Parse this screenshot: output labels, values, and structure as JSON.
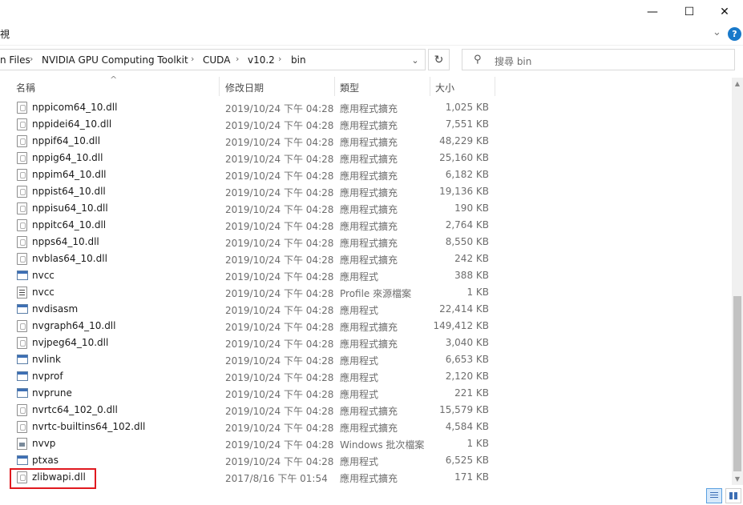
{
  "window": {
    "minimize_glyph": "—",
    "maximize_glyph": "☐",
    "close_glyph": "✕"
  },
  "ribbon": {
    "tab_fragment": "視",
    "help_glyph": "?"
  },
  "address": {
    "crumbs": [
      "n Files",
      "NVIDIA GPU Computing Toolkit",
      "CUDA",
      "v10.2",
      "bin"
    ],
    "separator": "›"
  },
  "search": {
    "placeholder": "搜尋 bin"
  },
  "columns": {
    "name": "名稱",
    "date": "修改日期",
    "type": "類型",
    "size": "大小"
  },
  "files": [
    {
      "name": "nppicom64_10.dll",
      "date": "2019/10/24 下午 04:28",
      "type": "應用程式擴充",
      "size": "1,025 KB",
      "icon": "dll-icon"
    },
    {
      "name": "nppidei64_10.dll",
      "date": "2019/10/24 下午 04:28",
      "type": "應用程式擴充",
      "size": "7,551 KB",
      "icon": "dll-icon"
    },
    {
      "name": "nppif64_10.dll",
      "date": "2019/10/24 下午 04:28",
      "type": "應用程式擴充",
      "size": "48,229 KB",
      "icon": "dll-icon"
    },
    {
      "name": "nppig64_10.dll",
      "date": "2019/10/24 下午 04:28",
      "type": "應用程式擴充",
      "size": "25,160 KB",
      "icon": "dll-icon"
    },
    {
      "name": "nppim64_10.dll",
      "date": "2019/10/24 下午 04:28",
      "type": "應用程式擴充",
      "size": "6,182 KB",
      "icon": "dll-icon"
    },
    {
      "name": "nppist64_10.dll",
      "date": "2019/10/24 下午 04:28",
      "type": "應用程式擴充",
      "size": "19,136 KB",
      "icon": "dll-icon"
    },
    {
      "name": "nppisu64_10.dll",
      "date": "2019/10/24 下午 04:28",
      "type": "應用程式擴充",
      "size": "190 KB",
      "icon": "dll-icon"
    },
    {
      "name": "nppitc64_10.dll",
      "date": "2019/10/24 下午 04:28",
      "type": "應用程式擴充",
      "size": "2,764 KB",
      "icon": "dll-icon"
    },
    {
      "name": "npps64_10.dll",
      "date": "2019/10/24 下午 04:28",
      "type": "應用程式擴充",
      "size": "8,550 KB",
      "icon": "dll-icon"
    },
    {
      "name": "nvblas64_10.dll",
      "date": "2019/10/24 下午 04:28",
      "type": "應用程式擴充",
      "size": "242 KB",
      "icon": "dll-icon"
    },
    {
      "name": "nvcc",
      "date": "2019/10/24 下午 04:28",
      "type": "應用程式",
      "size": "388 KB",
      "icon": "exe-icon"
    },
    {
      "name": "nvcc",
      "date": "2019/10/24 下午 04:28",
      "type": "Profile 來源檔案",
      "size": "1 KB",
      "icon": "text-file-icon"
    },
    {
      "name": "nvdisasm",
      "date": "2019/10/24 下午 04:28",
      "type": "應用程式",
      "size": "22,414 KB",
      "icon": "exe-icon"
    },
    {
      "name": "nvgraph64_10.dll",
      "date": "2019/10/24 下午 04:28",
      "type": "應用程式擴充",
      "size": "149,412 KB",
      "icon": "dll-icon"
    },
    {
      "name": "nvjpeg64_10.dll",
      "date": "2019/10/24 下午 04:28",
      "type": "應用程式擴充",
      "size": "3,040 KB",
      "icon": "dll-icon"
    },
    {
      "name": "nvlink",
      "date": "2019/10/24 下午 04:28",
      "type": "應用程式",
      "size": "6,653 KB",
      "icon": "exe-icon"
    },
    {
      "name": "nvprof",
      "date": "2019/10/24 下午 04:28",
      "type": "應用程式",
      "size": "2,120 KB",
      "icon": "exe-icon"
    },
    {
      "name": "nvprune",
      "date": "2019/10/24 下午 04:28",
      "type": "應用程式",
      "size": "221 KB",
      "icon": "exe-icon"
    },
    {
      "name": "nvrtc64_102_0.dll",
      "date": "2019/10/24 下午 04:28",
      "type": "應用程式擴充",
      "size": "15,579 KB",
      "icon": "dll-icon"
    },
    {
      "name": "nvrtc-builtins64_102.dll",
      "date": "2019/10/24 下午 04:28",
      "type": "應用程式擴充",
      "size": "4,584 KB",
      "icon": "dll-icon"
    },
    {
      "name": "nvvp",
      "date": "2019/10/24 下午 04:28",
      "type": "Windows 批次檔案",
      "size": "1 KB",
      "icon": "batch-file-icon"
    },
    {
      "name": "ptxas",
      "date": "2019/10/24 下午 04:28",
      "type": "應用程式",
      "size": "6,525 KB",
      "icon": "exe-icon"
    },
    {
      "name": "zlibwapi.dll",
      "date": "2017/8/16 下午 01:54",
      "type": "應用程式擴充",
      "size": "171 KB",
      "icon": "dll-icon"
    }
  ],
  "colors": {
    "highlight_box": "#e0191f",
    "accent": "#1979ca"
  }
}
